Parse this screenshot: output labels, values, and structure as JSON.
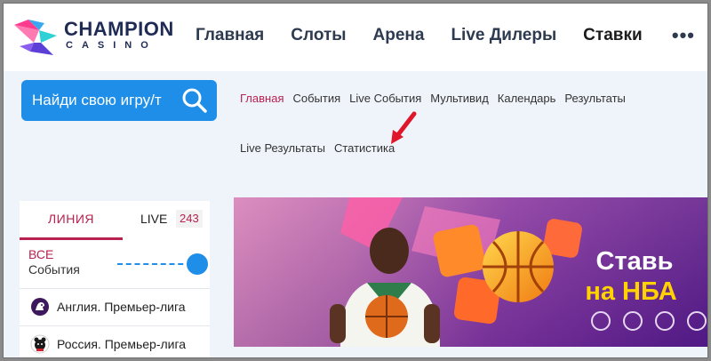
{
  "brand": {
    "name": "CHAMPION",
    "subtitle": "CASINO"
  },
  "nav": {
    "items": [
      "Главная",
      "Слоты",
      "Арена",
      "Live Дилеры",
      "Ставки"
    ],
    "more_icon": "more-dots-icon"
  },
  "search": {
    "placeholder": "Найди свою игру/т",
    "icon": "search-icon"
  },
  "submenu": {
    "row1": [
      "Главная",
      "События",
      "Live События",
      "Мультивид",
      "Календарь",
      "Результаты"
    ],
    "row2": [
      "Live Результаты",
      "Статистика"
    ],
    "active_index": 0
  },
  "sidebar": {
    "tab_line": "ЛИНИЯ",
    "tab_live": "LIVE",
    "live_count": "243",
    "all_label": "ВСЕ",
    "events_label": "События",
    "leagues": [
      {
        "name": "Англия. Премьер-лига",
        "icon": "premier-league-lion-icon"
      },
      {
        "name": "Россия. Премьер-лига",
        "icon": "russian-league-bear-icon"
      }
    ]
  },
  "banner": {
    "title": "Ставь",
    "subtitle": "на НБА"
  },
  "colors": {
    "accent": "#b82150",
    "primary_blue": "#1e8ee8",
    "banner_yellow": "#ffd200",
    "annotation_arrow": "#e0162b"
  }
}
